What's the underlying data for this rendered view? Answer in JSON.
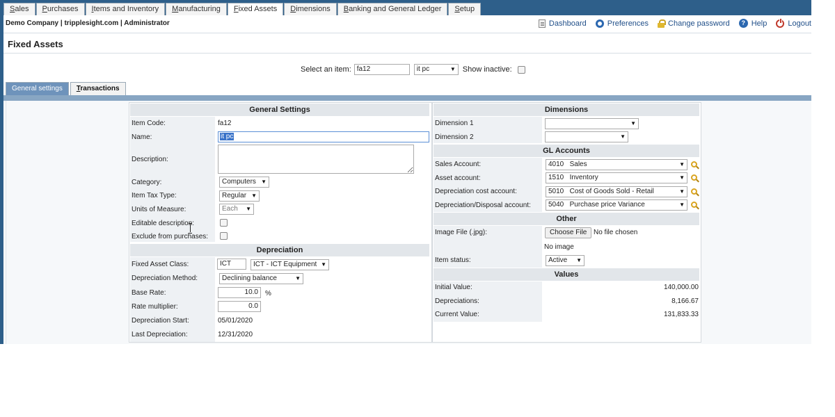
{
  "topnav": {
    "tabs": [
      {
        "label": "Sales",
        "underline": "S",
        "rest": "ales"
      },
      {
        "label": "Purchases",
        "underline": "P",
        "rest": "urchases"
      },
      {
        "label": "Items and Inventory",
        "underline": "I",
        "rest": "tems and Inventory"
      },
      {
        "label": "Manufacturing",
        "underline": "M",
        "rest": "anufacturing"
      },
      {
        "label": "Fixed Assets",
        "underline": "F",
        "rest": "ixed Assets",
        "active": true
      },
      {
        "label": "Dimensions",
        "underline": "D",
        "rest": "imensions"
      },
      {
        "label": "Banking and General Ledger",
        "underline": "B",
        "rest": "anking and General Ledger"
      },
      {
        "label": "Setup",
        "underline": "S",
        "rest": "etup"
      }
    ]
  },
  "header": {
    "company": "Demo Company | tripplesight.com | Administrator",
    "links": {
      "dashboard": "Dashboard",
      "preferences": "Preferences",
      "change_password": "Change password",
      "help": "Help",
      "logout": "Logout"
    }
  },
  "page": {
    "title": "Fixed Assets"
  },
  "select_bar": {
    "label": "Select an item:",
    "item_value": "fa12",
    "item_dropdown": "it pc",
    "show_inactive_label": "Show inactive:"
  },
  "subtabs": {
    "general": "General settings",
    "transactions_u": "T",
    "transactions_rest": "ransactions"
  },
  "general": {
    "header": "General Settings",
    "item_code_label": "Item Code:",
    "item_code": "fa12",
    "name_label": "Name:",
    "name_value": "it pc",
    "description_label": "Description:",
    "category_label": "Category:",
    "category": "Computers",
    "tax_type_label": "Item Tax Type:",
    "tax_type": "Regular",
    "units_label": "Units of Measure:",
    "units": "Each",
    "editable_label": "Editable description:",
    "exclude_label": "Exclude from purchases:"
  },
  "depreciation": {
    "header": "Depreciation",
    "class_label": "Fixed Asset Class:",
    "class_code": "ICT",
    "class_dropdown": "ICT - ICT Equipment",
    "method_label": "Depreciation Method:",
    "method": "Declining balance",
    "base_rate_label": "Base Rate:",
    "base_rate": "10.0",
    "percent": "%",
    "multiplier_label": "Rate multiplier:",
    "multiplier": "0.0",
    "start_label": "Depreciation Start:",
    "start": "05/01/2020",
    "last_label": "Last Depreciation:",
    "last": "12/31/2020"
  },
  "dimensions": {
    "header": "Dimensions",
    "dim1_label": "Dimension 1",
    "dim2_label": "Dimension 2"
  },
  "gl": {
    "header": "GL Accounts",
    "sales_label": "Sales Account:",
    "sales_code": "4010",
    "sales_name": "Sales",
    "asset_label": "Asset account:",
    "asset_code": "1510",
    "asset_name": "Inventory",
    "dep_cost_label": "Depreciation cost account:",
    "dep_cost_code": "5010",
    "dep_cost_name": "Cost of Goods Sold - Retail",
    "disposal_label": "Depreciation/Disposal account:",
    "disposal_code": "5040",
    "disposal_name": "Purchase price Variance"
  },
  "other": {
    "header": "Other",
    "image_label": "Image File (.jpg):",
    "choose_file": "Choose File",
    "no_file": "No file chosen",
    "no_image": "No image",
    "status_label": "Item status:",
    "status": "Active"
  },
  "values": {
    "header": "Values",
    "initial_label": "Initial Value:",
    "initial": "140,000.00",
    "depreciations_label": "Depreciations:",
    "depreciations": "8,166.67",
    "current_label": "Current Value:",
    "current": "131,833.33"
  },
  "colors": {
    "nav": "#2e5f8a",
    "accent": "#6e93bb",
    "link": "#1f4e88"
  }
}
